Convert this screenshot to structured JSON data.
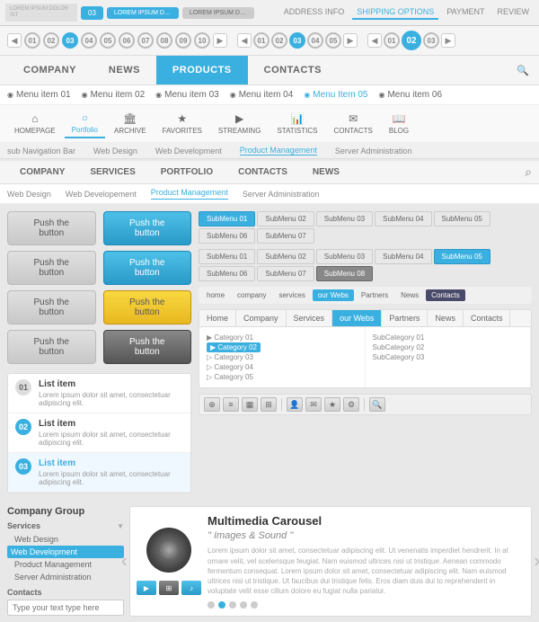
{
  "topbar": {
    "logo_text": "LOREM IPSUM DOLOR SIT",
    "tabs": [
      {
        "label": "03",
        "active": true
      },
      {
        "label": "LOREM IPSUM DOLOR SIT",
        "active": true
      },
      {
        "label": "LOREM IPSUM DOLOR SIT",
        "active": false
      }
    ],
    "nav_items": [
      {
        "label": "ADDRESS INFO",
        "active": false
      },
      {
        "label": "SHIPPING OPTIONS",
        "active": true
      },
      {
        "label": "PAYMENT",
        "active": false
      },
      {
        "label": "REVIEW",
        "active": false
      }
    ]
  },
  "step_bars": {
    "bar1": {
      "steps": [
        "01",
        "02",
        "03",
        "04",
        "05",
        "06",
        "07",
        "08",
        "09",
        "10"
      ]
    },
    "bar2": {
      "steps": [
        "01",
        "02",
        "03",
        "04",
        "05"
      ]
    },
    "bar3": {
      "steps": [
        "01",
        "02",
        "03"
      ]
    }
  },
  "main_nav": {
    "items": [
      {
        "label": "COMPANY"
      },
      {
        "label": "NEWS"
      },
      {
        "label": "PRODUCTS",
        "active": true
      },
      {
        "label": "CONTACTS"
      }
    ],
    "search_placeholder": "Search..."
  },
  "menu_items": {
    "items": [
      {
        "label": "Menu item 01"
      },
      {
        "label": "Menu item 02"
      },
      {
        "label": "Menu item 03"
      },
      {
        "label": "Menu item 04"
      },
      {
        "label": "Menu Item 05",
        "active": true
      },
      {
        "label": "Menu item 06"
      }
    ]
  },
  "sub_nav": {
    "items": [
      {
        "label": "HOMEPAGE",
        "icon": "🏠"
      },
      {
        "label": "Portfolio",
        "icon": "○",
        "active": true
      },
      {
        "label": "ARCHIVE",
        "icon": "🏛"
      },
      {
        "label": "FAVORITES",
        "icon": "★"
      },
      {
        "label": "STREAMING",
        "icon": "▶"
      },
      {
        "label": "STATISTICS",
        "icon": "📊"
      },
      {
        "label": "CONTACTS",
        "icon": "📧"
      },
      {
        "label": "BLOG",
        "icon": "📖"
      }
    ],
    "sub_labels": [
      "sub Navigation Bar",
      "Web Design",
      "Web Development",
      "Product Management",
      "Server Administration"
    ]
  },
  "second_nav": {
    "items": [
      {
        "label": "COMPANY"
      },
      {
        "label": "SERVICES"
      },
      {
        "label": "PORTFOLIO"
      },
      {
        "label": "CONTACTS"
      },
      {
        "label": "NEWS"
      }
    ],
    "sub_items": [
      {
        "label": "Web Design"
      },
      {
        "label": "Web Developement"
      },
      {
        "label": "Product Management",
        "active": true
      },
      {
        "label": "Server Administration"
      }
    ]
  },
  "buttons": {
    "push_label": "Push the button",
    "rows": [
      {
        "left": "gray",
        "right": "blue"
      },
      {
        "left": "gray",
        "right": "blue"
      },
      {
        "left": "gray",
        "right": "yellow"
      },
      {
        "left": "gray",
        "right": "dark"
      }
    ]
  },
  "list_items": {
    "items": [
      {
        "num": "01",
        "title": "List item",
        "desc": "Lorem ipsum dolor sit amet, consectetuar adipiscing elit.",
        "active": false
      },
      {
        "num": "02",
        "title": "List item",
        "desc": "Lorem ipsum dolor sit amet, consectetuar adipiscing elit.",
        "active": false,
        "blue": true
      },
      {
        "num": "03",
        "title": "List item",
        "desc": "Lorem ipsum dolor sit amet, consectetuar adipiscing elit.",
        "active": true,
        "blue_title": true
      }
    ]
  },
  "tabs": {
    "row1": [
      "SubMenu 01",
      "SubMenu 02",
      "SubMenu 03",
      "SubMenu 04",
      "SubMenu 05",
      "SubMenu 06",
      "SubMenu 07"
    ],
    "row2": [
      "SubMenu 01",
      "SubMenu 02",
      "SubMenu 03",
      "SubMenu 04",
      "SubMenu 05",
      "SubMenu 06",
      "SubMenu 07",
      "SubMenu 08"
    ],
    "active_row2": 7
  },
  "small_nav": {
    "items": [
      "home",
      "company",
      "services",
      "our Webs",
      "Partners",
      "News",
      "Contacts"
    ],
    "active": "our Webs"
  },
  "mega_nav": {
    "top": [
      "Home",
      "Company",
      "Services",
      "our Webs",
      "Partners",
      "News",
      "Contacts"
    ],
    "active_top": "our Webs",
    "categories": [
      "Category 01",
      "Category 02",
      "Category 03",
      "Category 04",
      "Category 05"
    ],
    "active_category": "Category 02",
    "subcategories": [
      "SubCategory 01",
      "SubCategory 02",
      "SubCategory 03"
    ]
  },
  "company_group": {
    "title": "Company Group",
    "services_label": "Services",
    "contacts_label": "Contacts",
    "services_items": [
      {
        "label": "Web Design"
      },
      {
        "label": "Web Development",
        "active": true
      },
      {
        "label": "Product Management"
      },
      {
        "label": "Server Administration"
      }
    ],
    "input_placeholder": "Type your text type here"
  },
  "carousel": {
    "title": "Multimedia Carousel",
    "subtitle": "\" Images & Sound \"",
    "text": "Lorem ipsum dolor sit amet, consectetuar adipiscing elit. Ut venenatis imperdiet hendrerit. In at ornare velit, vel scelerisque feugiat. Nam euismod ultrices nisi ut tristique. Aenean commodo fermentum consequat. Lorem ipsum dolor sit amet, consectetuar adipiscing elit. Nam euismod ultrices nisi ut tristique. Ut faucibus dui tristique felis. Eros diam duis dui to reprehenderit in voluptate velit esse cillum dolore eu fugiat nulla pariatur.",
    "dots": 5,
    "active_dot": 2
  }
}
